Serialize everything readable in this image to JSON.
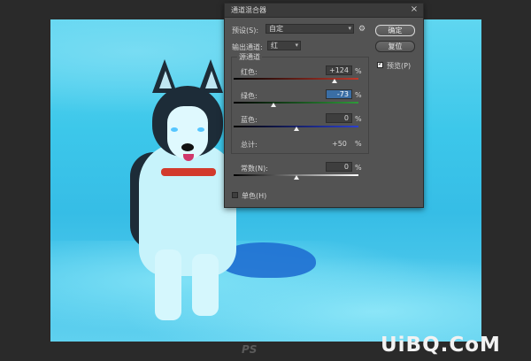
{
  "dialog": {
    "title": "通道混合器",
    "close_glyph": "×",
    "preset_label": "预设(S):",
    "preset_value": "自定",
    "output_channel_label": "输出通道:",
    "output_channel_value": "红",
    "source_channels_label": "源通道",
    "channels": [
      {
        "label": "红色:",
        "value": "+124",
        "unit": "%",
        "level": 124,
        "track_color": "#c0392b"
      },
      {
        "label": "绿色:",
        "value": "-73",
        "unit": "%",
        "level": -73,
        "track_color": "#2e9a3a"
      },
      {
        "label": "蓝色:",
        "value": "0",
        "unit": "%",
        "level": 0,
        "track_color": "#2b3fcf"
      }
    ],
    "total_label": "总计:",
    "total_value": "+50",
    "total_unit": "%",
    "constant_label": "常数(N):",
    "constant_value": "0",
    "constant_unit": "%",
    "constant_level": 0,
    "monochrome_label": "单色(H)",
    "monochrome_checked": false,
    "buttons": {
      "ok": "确定",
      "reset": "复位"
    },
    "preview_label": "预览(P)",
    "preview_checked": true
  },
  "watermarks": {
    "site": "UiBQ.CoM",
    "ps": "PS"
  },
  "icons": {
    "gear": "gear-icon",
    "close": "close-icon",
    "dropdown": "chevron-down-icon"
  }
}
